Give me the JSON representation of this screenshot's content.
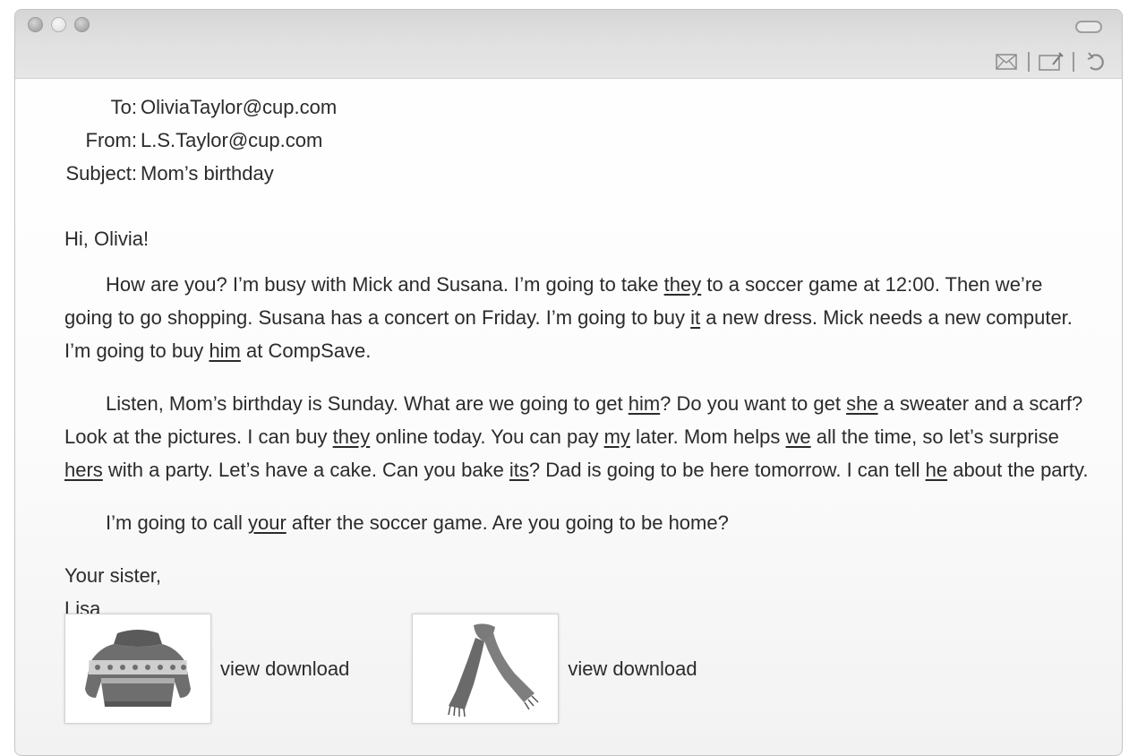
{
  "toolbar": {
    "icons": [
      "envelope-icon",
      "compose-icon",
      "refresh-icon"
    ]
  },
  "header": {
    "to_label": "To:",
    "to_value": "OliviaTaylor@cup.com",
    "from_label": "From:",
    "from_value": "L.S.Taylor@cup.com",
    "subject_label": "Subject:",
    "subject_value": "Mom’s birthday"
  },
  "body": {
    "greeting": "Hi, Olivia!",
    "p1": [
      "How are you? I’m busy with Mick and Susana. I’m going to take ",
      "they",
      " to a soccer game at 12:00. Then we’re going to go shopping. Susana has a concert on Friday. I’m going to buy ",
      "it",
      " a new dress. Mick needs a new computer. I’m going to buy ",
      "him",
      " at CompSave."
    ],
    "p2": [
      "Listen, Mom’s birthday is Sunday. What are we going to get ",
      "him",
      "? Do you want to get ",
      "she",
      " a sweater and a scarf? Look at the pictures. I can buy ",
      "they",
      " online today. You can pay ",
      "my",
      " later. Mom helps ",
      "we",
      " all the time, so let’s surprise ",
      "hers",
      " with a party. Let’s have a cake. Can you bake ",
      "its",
      "? Dad is going to be here tomorrow. I can tell ",
      "he",
      " about the party."
    ],
    "p3": [
      "I’m going to call ",
      "your",
      " after the soccer game. Are you going to be home?"
    ],
    "closing": "Your sister,",
    "signature": "Lisa"
  },
  "attachments": [
    {
      "image": "sweater-image",
      "label": "view download"
    },
    {
      "image": "scarf-image",
      "label": "view download"
    }
  ]
}
